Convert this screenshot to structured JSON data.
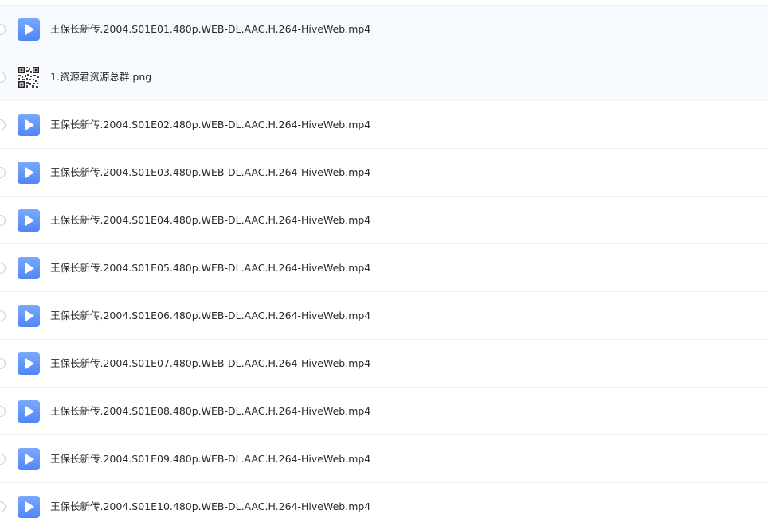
{
  "files": [
    {
      "name": "王保长新传.2004.S01E01.480p.WEB-DL.AAC.H.264-HiveWeb.mp4",
      "type": "video",
      "icon": "video-file-icon"
    },
    {
      "name": "1.资源君资源总群.png",
      "type": "image",
      "icon": "qr-code-image-icon"
    },
    {
      "name": "王保长新传.2004.S01E02.480p.WEB-DL.AAC.H.264-HiveWeb.mp4",
      "type": "video",
      "icon": "video-file-icon"
    },
    {
      "name": "王保长新传.2004.S01E03.480p.WEB-DL.AAC.H.264-HiveWeb.mp4",
      "type": "video",
      "icon": "video-file-icon"
    },
    {
      "name": "王保长新传.2004.S01E04.480p.WEB-DL.AAC.H.264-HiveWeb.mp4",
      "type": "video",
      "icon": "video-file-icon"
    },
    {
      "name": "王保长新传.2004.S01E05.480p.WEB-DL.AAC.H.264-HiveWeb.mp4",
      "type": "video",
      "icon": "video-file-icon"
    },
    {
      "name": "王保长新传.2004.S01E06.480p.WEB-DL.AAC.H.264-HiveWeb.mp4",
      "type": "video",
      "icon": "video-file-icon"
    },
    {
      "name": "王保长新传.2004.S01E07.480p.WEB-DL.AAC.H.264-HiveWeb.mp4",
      "type": "video",
      "icon": "video-file-icon"
    },
    {
      "name": "王保长新传.2004.S01E08.480p.WEB-DL.AAC.H.264-HiveWeb.mp4",
      "type": "video",
      "icon": "video-file-icon"
    },
    {
      "name": "王保长新传.2004.S01E09.480p.WEB-DL.AAC.H.264-HiveWeb.mp4",
      "type": "video",
      "icon": "video-file-icon"
    },
    {
      "name": "王保长新传.2004.S01E10.480p.WEB-DL.AAC.H.264-HiveWeb.mp4",
      "type": "video",
      "icon": "video-file-icon"
    }
  ],
  "colors": {
    "video_icon": "#5b8ff9",
    "row_hover": "#f6f9fe",
    "divider": "#eef0f4"
  }
}
